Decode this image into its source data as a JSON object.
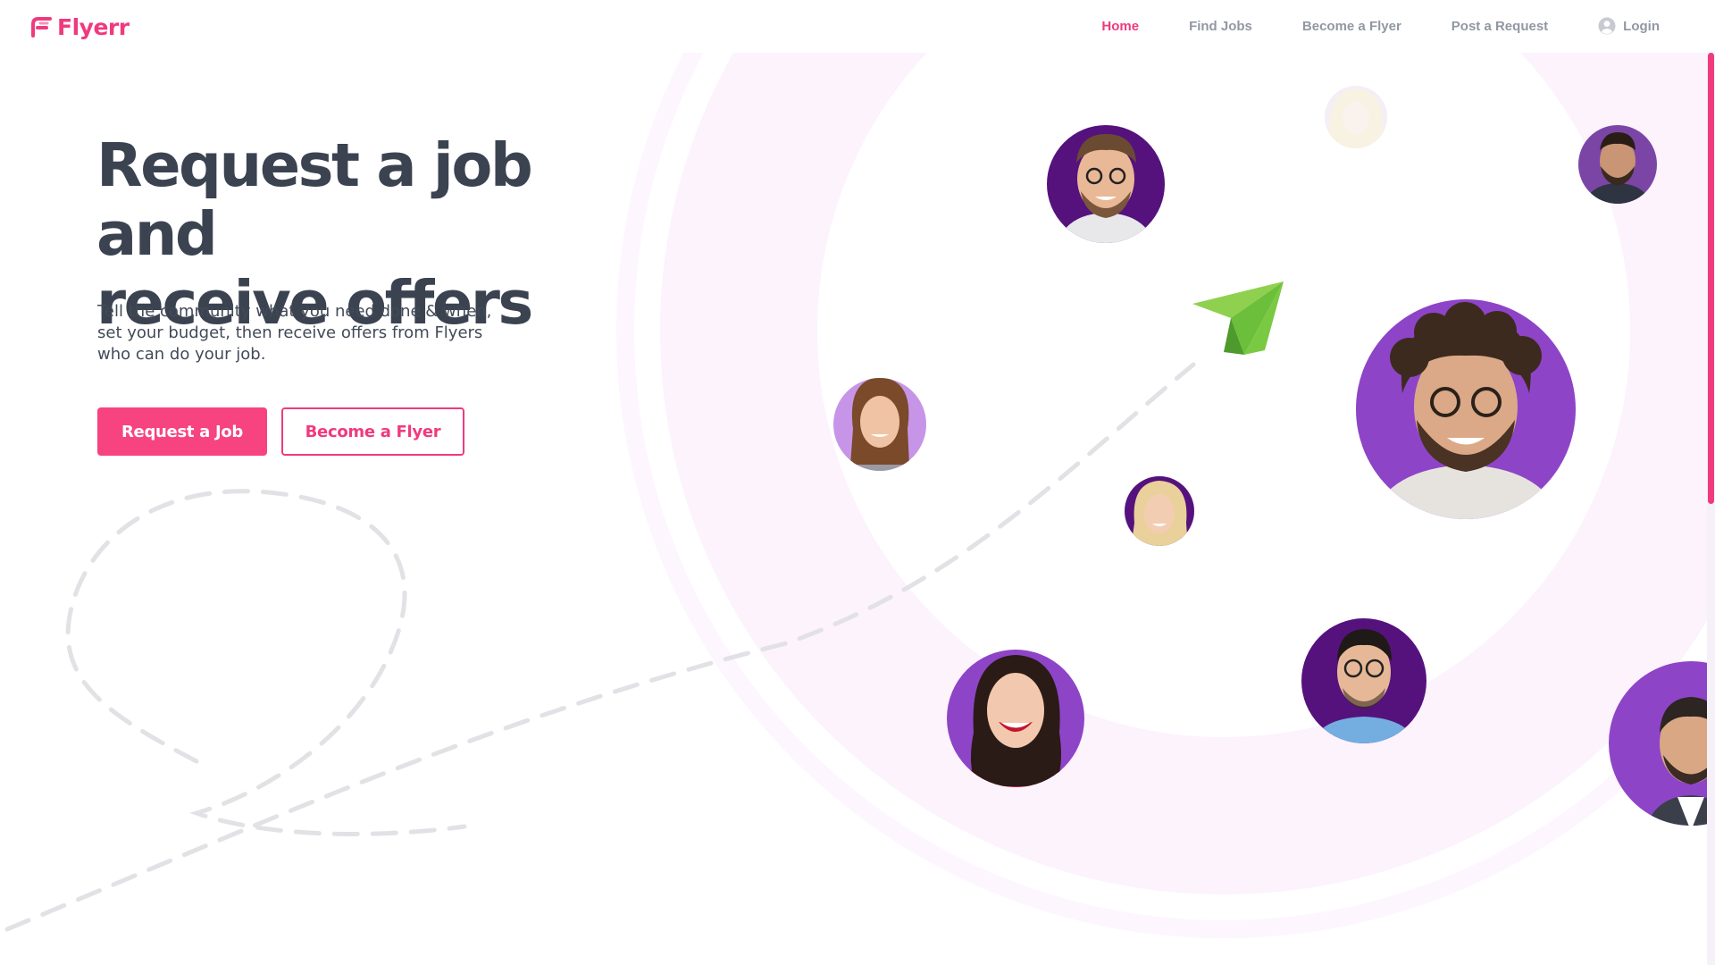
{
  "brand": {
    "name": "Flyerr",
    "color": "#f03a7e"
  },
  "nav": {
    "items": [
      {
        "label": "Home",
        "active": true
      },
      {
        "label": "Find Jobs",
        "active": false
      },
      {
        "label": "Become a Flyer",
        "active": false
      },
      {
        "label": "Post a Request",
        "active": false
      }
    ],
    "login": {
      "label": "Login",
      "icon": "user-circle-icon"
    }
  },
  "hero": {
    "title_line1": "Request a job and",
    "title_line2": "receive offers",
    "description": "Tell the community what you need done & when, set your budget, then receive offers from Flyers who can do your job.",
    "primary_button": "Request a Job",
    "secondary_button": "Become a Flyer"
  },
  "illustration": {
    "icon": "paper-plane-icon",
    "colors": {
      "ring": "#fcf4fd",
      "dash": "#e2e2e6",
      "plane_light": "#8fd14f",
      "plane_dark": "#5aa832",
      "avatar_purple": "#8e44c7",
      "avatar_dark": "#55127d"
    },
    "avatars": [
      {
        "name": "avatar-man-glasses-hoodie"
      },
      {
        "name": "avatar-faded-woman"
      },
      {
        "name": "avatar-man-beard-small"
      },
      {
        "name": "avatar-man-curly-hair"
      },
      {
        "name": "avatar-woman-brown-hair"
      },
      {
        "name": "avatar-woman-blonde"
      },
      {
        "name": "avatar-woman-smiling"
      },
      {
        "name": "avatar-man-glasses-denim"
      },
      {
        "name": "avatar-man-suit"
      }
    ]
  },
  "accent_color": "#f7437f",
  "text_color": "#3b4351"
}
